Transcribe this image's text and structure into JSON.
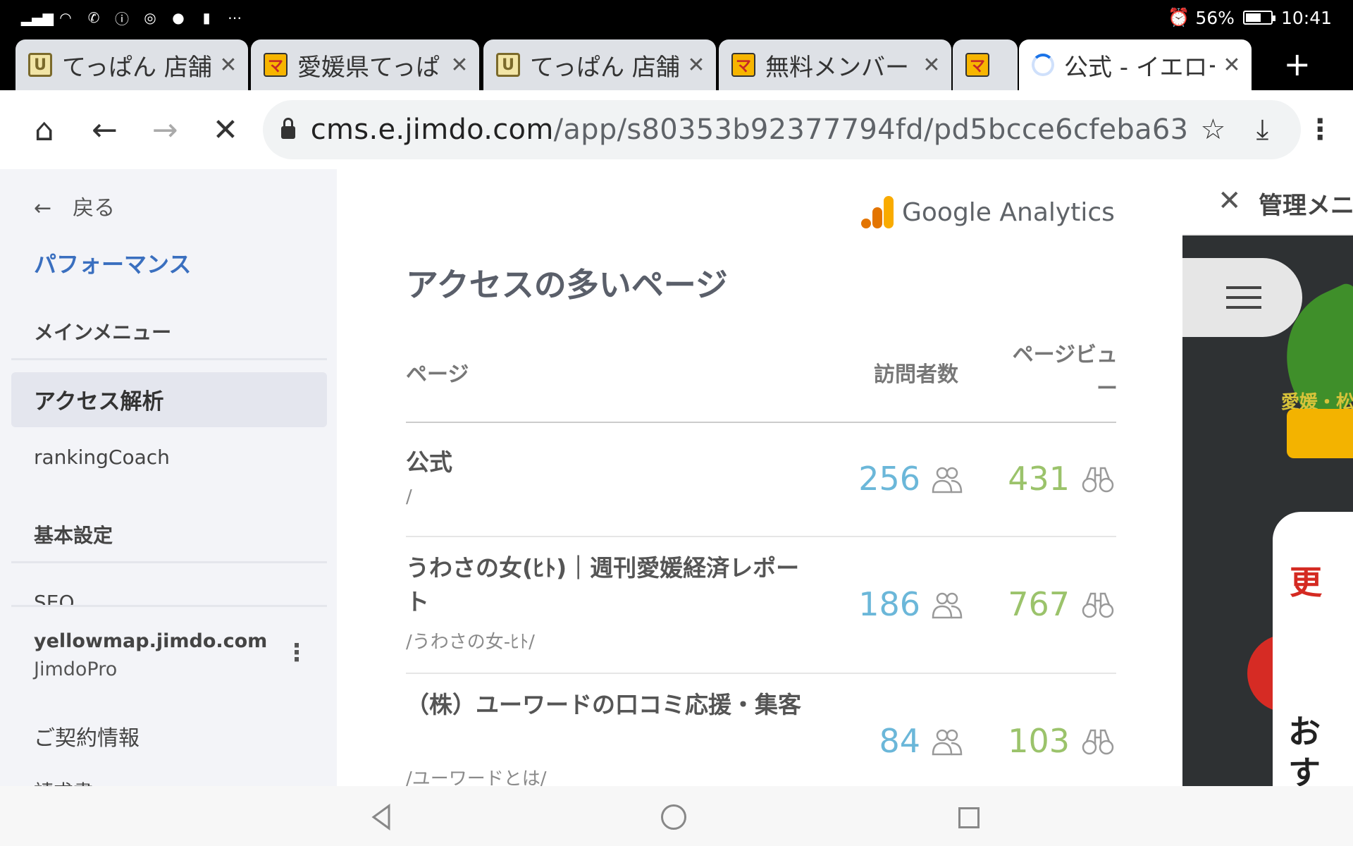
{
  "status_bar": {
    "battery": "56%",
    "time": "10:41",
    "left_icons": [
      "signal-icon",
      "wifi-icon",
      "call-icon",
      "info-icon",
      "instagram-icon",
      "line-icon",
      "sim-icon",
      "more-icon"
    ]
  },
  "tabs": [
    {
      "title": "てっぱん 店舗",
      "favicon": "shield"
    },
    {
      "title": "愛媛県てっぱ",
      "favicon": "mark"
    },
    {
      "title": "てっぱん 店舗",
      "favicon": "shield"
    },
    {
      "title": "無料メンバー",
      "favicon": "mark"
    },
    {
      "title": "",
      "favicon": "mark"
    },
    {
      "title": "公式 - イエロー",
      "favicon": "loading",
      "active": true
    }
  ],
  "address_bar": {
    "host": "cms.e.jimdo.com",
    "path": "/app/s80353b92377794fd/pd5bcce6cfeba63"
  },
  "sidebar": {
    "back_label": "戻る",
    "section_title": "パフォーマンス",
    "items": [
      {
        "label": "メインメニュー"
      },
      {
        "label": "アクセス解析",
        "active": true
      },
      {
        "label": "rankingCoach"
      },
      {
        "label": "基本設定"
      },
      {
        "label": "SEO"
      }
    ],
    "site": "yellowmap.jimdo.com",
    "plan": "JimdoPro",
    "contract": "ご契約情報",
    "invoice": "請求書"
  },
  "main": {
    "ga_brand": "Google Analytics",
    "heading": "アクセスの多いページ",
    "columns": {
      "page": "ページ",
      "visitors": "訪問者数",
      "pageviews": "ページビュー"
    },
    "rows": [
      {
        "title": "公式",
        "path": "/",
        "visitors": "256",
        "views": "431"
      },
      {
        "title": "うわさの女(ﾋﾄ)｜週刊愛媛経済レポート",
        "path": "/うわさの女-ﾋﾄ/",
        "visitors": "186",
        "views": "767"
      },
      {
        "title": "（株）ユーワードの口コミ応援・集客",
        "path": "/ユーワードとは/",
        "visitors": "84",
        "views": "103"
      }
    ]
  },
  "right_panel": {
    "title": "管理メニュー",
    "text_yellow": "愛媛・松",
    "text_red": "更",
    "text_o": "お",
    "text_su": "す"
  },
  "colors": {
    "accent_blue": "#3a6fbf",
    "visitors": "#6bb7d9",
    "pageviews": "#9bc36b"
  }
}
